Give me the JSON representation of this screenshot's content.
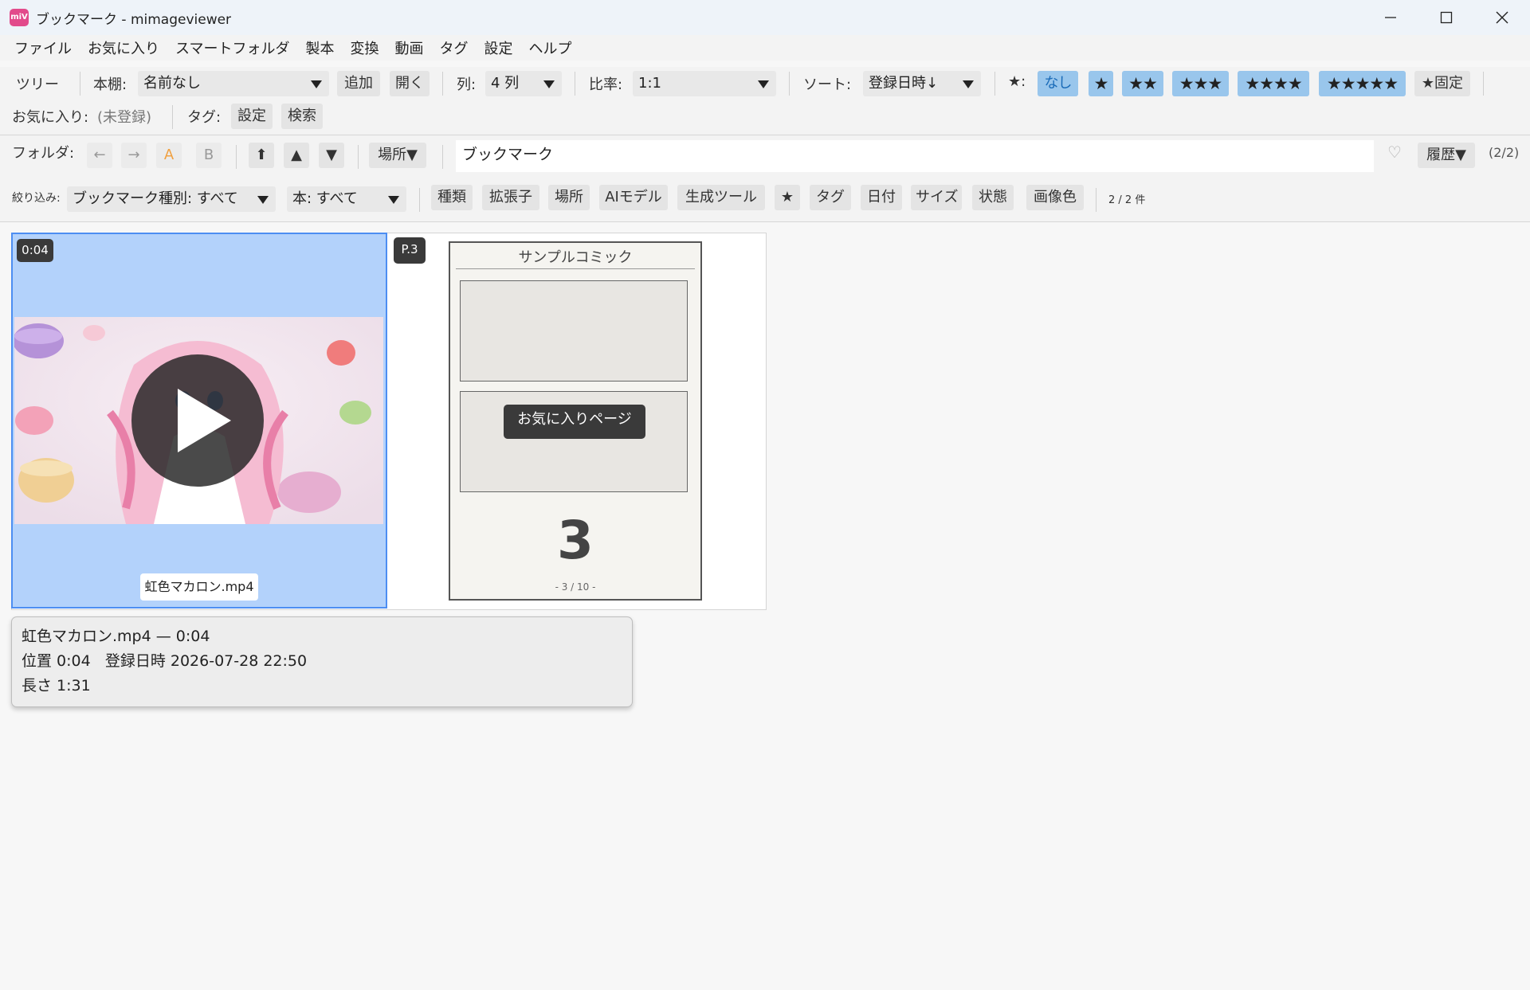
{
  "window": {
    "title": "ブックマーク - mimageviewer",
    "app_icon": "miV"
  },
  "menu": [
    "ファイル",
    "お気に入り",
    "スマートフォルダ",
    "製本",
    "変換",
    "動画",
    "タグ",
    "設定",
    "ヘルプ"
  ],
  "toolbar": {
    "tree": "ツリー",
    "shelf_label": "本棚:",
    "shelf_value": "名前なし",
    "add": "追加",
    "open": "開く",
    "cols_label": "列:",
    "cols_value": "4 列",
    "ratio_label": "比率:",
    "ratio_value": "1:1",
    "sort_label": "ソート:",
    "sort_value": "登録日時↓",
    "star_label": "★:",
    "star_none": "なし",
    "stars": [
      "★",
      "★★",
      "★★★",
      "★★★★",
      "★★★★★"
    ],
    "star_fixed": "★固定",
    "fav_label": "お気に入り:",
    "fav_value": "(未登録)",
    "tag_label": "タグ:",
    "tag_set": "設定",
    "tag_search": "検索"
  },
  "folder_bar": {
    "label": "フォルダ:",
    "back": "←",
    "forward": "→",
    "a": "A",
    "b": "B",
    "top": "⬆",
    "up": "▲",
    "down": "▼",
    "place": "場所▼",
    "path": "ブックマーク",
    "history": "履歴▼",
    "count": "(2/2)"
  },
  "filter_bar": {
    "label": "絞り込み:",
    "bookmark_type": "ブックマーク種別: すべて",
    "book": "本: すべて",
    "chips": [
      "種類",
      "拡張子",
      "場所",
      "AIモデル",
      "生成ツール",
      "★",
      "タグ",
      "日付",
      "サイズ",
      "状態",
      "画像色"
    ],
    "count": "2 / 2 件"
  },
  "cards": {
    "video": {
      "timestamp": "0:04",
      "filename": "虹色マカロン.mp4"
    },
    "page": {
      "badge": "P.3",
      "title": "サンプルコミック",
      "favorite_label": "お気に入りページ",
      "number": "3",
      "page_info": "- 3 / 10 -"
    }
  },
  "tooltip": {
    "line1": "虹色マカロン.mp4 — 0:04",
    "line2": "位置 0:04   登録日時 2026-07-28 22:50",
    "line3": "長さ 1:31"
  },
  "colors": {
    "accent": "#4d8ef2",
    "selection": "#b3d2fb",
    "star_button": "#99c6ec",
    "app_icon": "#e24a8b"
  }
}
